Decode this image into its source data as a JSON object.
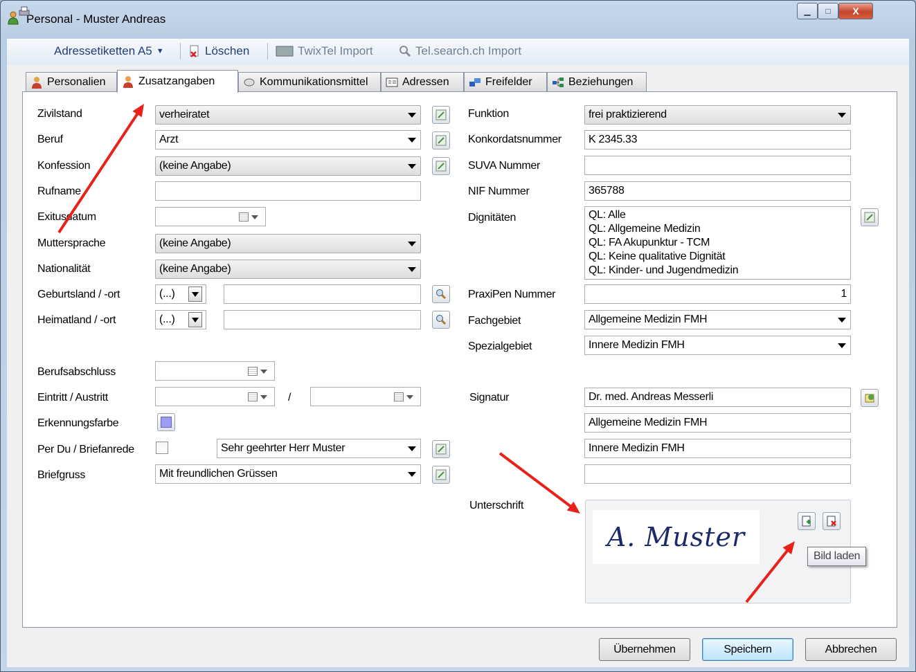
{
  "window": {
    "title": "Personal - Muster Andreas"
  },
  "toolbar": {
    "address_labels": "Adressetiketten A5",
    "delete": "Löschen",
    "twixtel_import": "TwixTel Import",
    "telsearch_import": "Tel.search.ch Import"
  },
  "tabs": [
    "Personalien",
    "Zusatzangaben",
    "Kommunikationsmittel",
    "Adressen",
    "Freifelder",
    "Beziehungen"
  ],
  "left": {
    "zivilstand": {
      "label": "Zivilstand",
      "value": "verheiratet"
    },
    "beruf": {
      "label": "Beruf",
      "value": "Arzt"
    },
    "konfession": {
      "label": "Konfession",
      "value": "(keine Angabe)"
    },
    "rufname": {
      "label": "Rufname",
      "value": ""
    },
    "exitusdatum": {
      "label": "Exitusdatum"
    },
    "muttersprache": {
      "label": "Muttersprache",
      "value": "(keine Angabe)"
    },
    "nationalitaet": {
      "label": "Nationalität",
      "value": "(keine Angabe)"
    },
    "geburtsland": {
      "label": "Geburtsland / -ort",
      "country": "(...)",
      "place": ""
    },
    "heimatland": {
      "label": "Heimatland / -ort",
      "country": "(...)",
      "place": ""
    },
    "berufsabschluss": {
      "label": "Berufsabschluss"
    },
    "eintritt": {
      "label": "Eintritt / Austritt",
      "separator": "/"
    },
    "erkennungsfarbe": {
      "label": "Erkennungsfarbe",
      "color": "#9e9bf5"
    },
    "perdu": {
      "label": "Per Du / Briefanrede",
      "salutation": "Sehr geehrter Herr Muster"
    },
    "briefgruss": {
      "label": "Briefgruss",
      "value": "Mit freundlichen Grüssen"
    }
  },
  "right": {
    "funktion": {
      "label": "Funktion",
      "value": "frei praktizierend"
    },
    "konkordat": {
      "label": "Konkordatsnummer",
      "value": "K 2345.33"
    },
    "suva": {
      "label": "SUVA Nummer",
      "value": ""
    },
    "nif": {
      "label": "NIF Nummer",
      "value": "365788"
    },
    "dignitaeten": {
      "label": "Dignitäten",
      "items": [
        "QL: Alle",
        "QL: Allgemeine Medizin",
        "QL: FA Akupunktur - TCM",
        "QL: Keine qualitative Dignität",
        "QL: Kinder- und Jugendmedizin"
      ]
    },
    "praxipen": {
      "label": "PraxiPen Nummer",
      "value": "1"
    },
    "fachgebiet": {
      "label": "Fachgebiet",
      "value": "Allgemeine Medizin FMH"
    },
    "spezialgebiet": {
      "label": "Spezialgebiet",
      "value": "Innere Medizin FMH"
    },
    "signatur": {
      "label": "Signatur",
      "lines": [
        "Dr. med. Andreas Messerli",
        "Allgemeine Medizin FMH",
        "Innere Medizin FMH",
        ""
      ]
    },
    "unterschrift": {
      "label": "Unterschrift",
      "signature_text": "A. Muster",
      "tooltip": "Bild laden"
    }
  },
  "buttons": {
    "apply": "Übernehmen",
    "save": "Speichern",
    "cancel": "Abbrechen"
  },
  "colors": {
    "annotation_arrow": "#e8221b",
    "accent_link": "#1f3f7a"
  }
}
